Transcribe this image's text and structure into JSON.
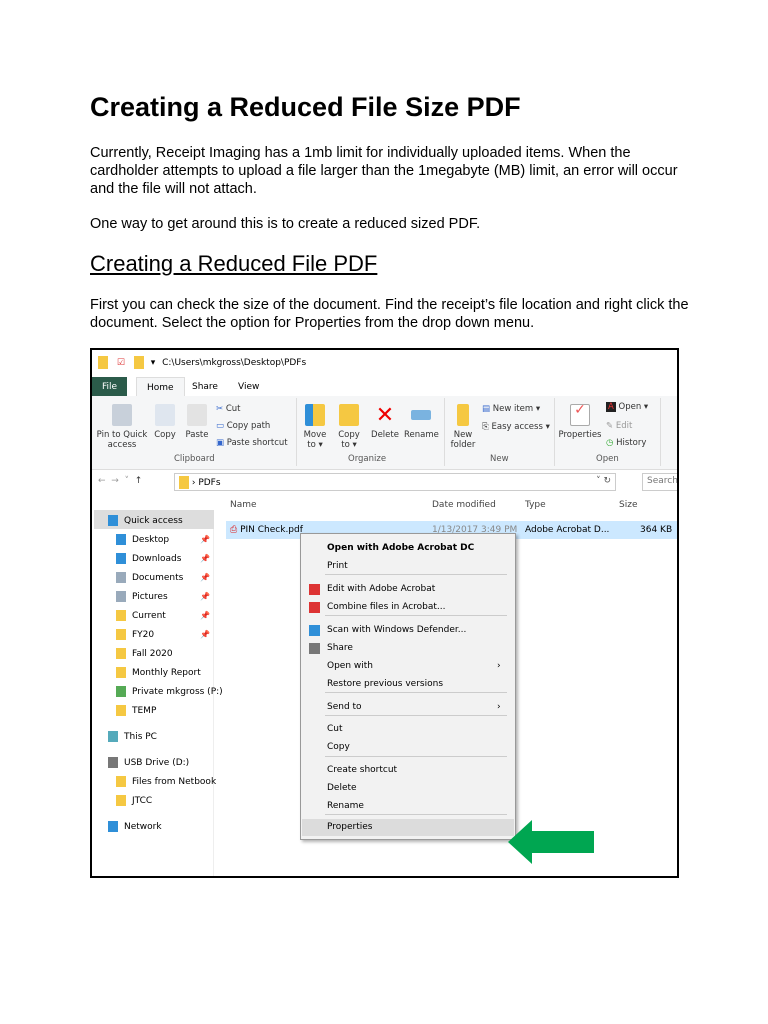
{
  "title": "Creating a Reduced File Size PDF",
  "para1": "Currently, Receipt Imaging has a 1mb limit for individually uploaded items. When the cardholder attempts to upload a file larger than the 1megabyte (MB) limit, an error will occur and the file will not attach.",
  "para2": "One way to get around this is to create a reduced sized PDF.",
  "subtitle": "Creating a Reduced File PDF",
  "para3": "First you can check the size of the document. Find the receipt’s file location and right click the document. Select the option for Properties from the drop down menu.",
  "explorer": {
    "path": "C:\\Users\\mkgross\\Desktop\\PDFs",
    "tabs": [
      "File",
      "Home",
      "Share",
      "View"
    ],
    "ribbon": {
      "pin": "Pin to Quick access",
      "copy": "Copy",
      "paste": "Paste",
      "cut": "Cut",
      "copy_path": "Copy path",
      "paste_shortcut": "Paste shortcut",
      "clipboard": "Clipboard",
      "move_to": "Move to ▾",
      "copy_to": "Copy to ▾",
      "delete": "Delete",
      "rename": "Rename",
      "organize": "Organize",
      "new_folder": "New folder",
      "new_item": "New item ▾",
      "easy_access": "Easy access ▾",
      "new": "New",
      "properties": "Properties",
      "open": "Open ▾",
      "edit": "Edit",
      "history": "History",
      "open_group": "Open"
    },
    "address": "PDFs",
    "search": "Search",
    "columns": [
      "Name",
      "Date modified",
      "Type",
      "Size"
    ],
    "file": {
      "name": "PIN Check.pdf",
      "date": "1/13/2017 3:49 PM",
      "type": "Adobe Acrobat D...",
      "size": "364 KB"
    },
    "nav": [
      "Quick access",
      "Desktop",
      "Downloads",
      "Documents",
      "Pictures",
      "Current",
      "FY20",
      "Fall 2020",
      "Monthly Report",
      "Private mkgross (P:)",
      "TEMP",
      "This PC",
      "USB Drive (D:)",
      "Files from Netbook",
      "JTCC",
      "Network"
    ],
    "menu": [
      "Open with Adobe Acrobat DC",
      "Print",
      "Edit with Adobe Acrobat",
      "Combine files in Acrobat...",
      "Scan with Windows Defender...",
      "Share",
      "Open with",
      "Restore previous versions",
      "Send to",
      "Cut",
      "Copy",
      "Create shortcut",
      "Delete",
      "Rename",
      "Properties"
    ]
  }
}
